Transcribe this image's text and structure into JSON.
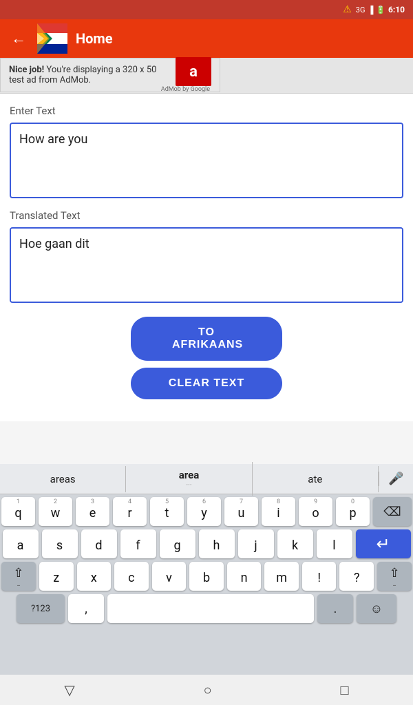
{
  "status_bar": {
    "network": "3G",
    "time": "6:10",
    "signal_icon": "signal-icon",
    "battery_icon": "battery-icon"
  },
  "top_bar": {
    "back_label": "←",
    "title": "Home",
    "flag_alt": "South Africa Flag"
  },
  "ad": {
    "text_bold": "Nice job!",
    "text_normal": " You're displaying a 320 x 50 test ad from AdMob.",
    "logo_letter": "a",
    "provider": "AdMob by Google"
  },
  "enter_text_label": "Enter Text",
  "input_text": "How are you",
  "translated_text_label": "Translated Text",
  "translated_text": "Hoe gaan dit",
  "buttons": {
    "to_afrikaans": "TO AFRIKAANS",
    "clear_text": "CLEAR TEXT"
  },
  "keyboard": {
    "suggestions": [
      {
        "label": "areas",
        "bold": false
      },
      {
        "label": "area",
        "bold": true
      },
      {
        "label": "ate",
        "bold": false
      }
    ],
    "rows": [
      {
        "keys": [
          {
            "num": "1",
            "letter": "q"
          },
          {
            "num": "2",
            "letter": "w"
          },
          {
            "num": "3",
            "letter": "e"
          },
          {
            "num": "4",
            "letter": "r"
          },
          {
            "num": "5",
            "letter": "t"
          },
          {
            "num": "6",
            "letter": "y"
          },
          {
            "num": "7",
            "letter": "u"
          },
          {
            "num": "8",
            "letter": "i"
          },
          {
            "num": "9",
            "letter": "o"
          },
          {
            "num": "0",
            "letter": "p"
          }
        ]
      },
      {
        "keys": [
          {
            "num": "",
            "letter": "a"
          },
          {
            "num": "",
            "letter": "s"
          },
          {
            "num": "",
            "letter": "d"
          },
          {
            "num": "",
            "letter": "f"
          },
          {
            "num": "",
            "letter": "g"
          },
          {
            "num": "",
            "letter": "h"
          },
          {
            "num": "",
            "letter": "j"
          },
          {
            "num": "",
            "letter": "k"
          },
          {
            "num": "",
            "letter": "l"
          }
        ]
      },
      {
        "special_left": "⇧",
        "keys": [
          {
            "num": "",
            "letter": "z"
          },
          {
            "num": "",
            "letter": "x"
          },
          {
            "num": "",
            "letter": "c"
          },
          {
            "num": "",
            "letter": "v"
          },
          {
            "num": "",
            "letter": "b"
          },
          {
            "num": "",
            "letter": "n"
          },
          {
            "num": "",
            "letter": "m"
          },
          {
            "num": "",
            "letter": "!"
          },
          {
            "num": "",
            "letter": "?"
          }
        ],
        "special_right": "⇧"
      }
    ],
    "bottom_row": {
      "num_switch": "?123",
      "comma": ",",
      "space": "",
      "period": ".",
      "emoji": "☺"
    }
  },
  "nav_bar": {
    "back": "▽",
    "home": "○",
    "recent": "□"
  }
}
